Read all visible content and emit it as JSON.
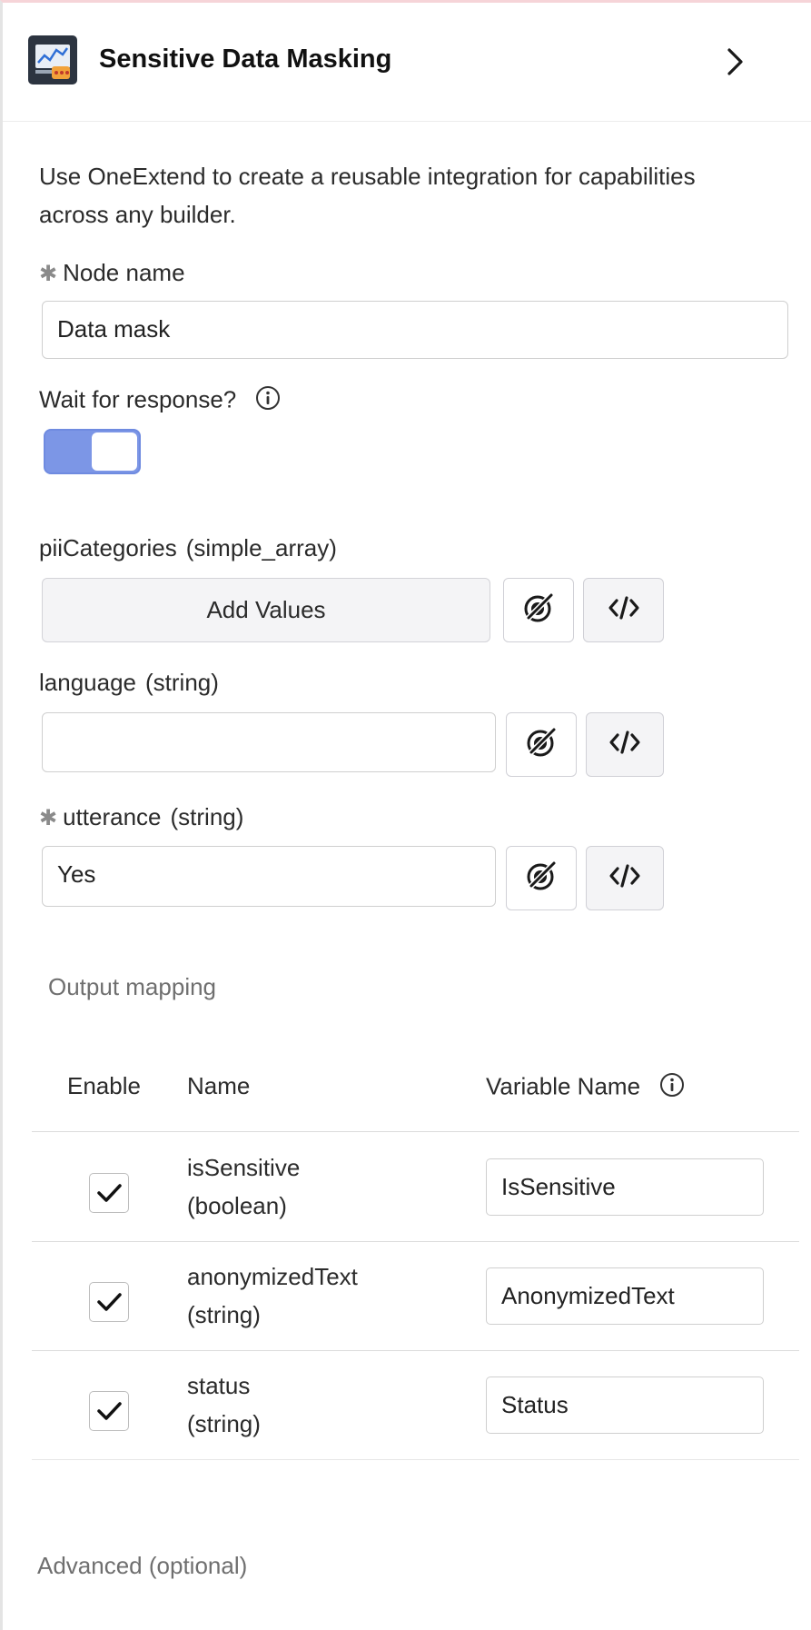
{
  "header": {
    "title": "Sensitive Data Masking",
    "app_icon": "data-masking-app-icon",
    "chevron_icon": "chevron-right-icon"
  },
  "description": "Use OneExtend to create a reusable integration for capabilities across any builder.",
  "node_name": {
    "required_mark": "✱",
    "label": "Node name",
    "value": "Data mask"
  },
  "wait_for_response": {
    "label": "Wait for response?",
    "enabled": true
  },
  "inputs": {
    "pii_categories": {
      "label": "piiCategories",
      "type": "(simple_array)",
      "button_label": "Add Values"
    },
    "language": {
      "label": "language",
      "type": "(string)",
      "value": ""
    },
    "utterance": {
      "required_mark": "✱",
      "label": "utterance",
      "type": "(string)",
      "value": "Yes"
    }
  },
  "output_mapping": {
    "title": "Output mapping",
    "columns": {
      "enable": "Enable",
      "name": "Name",
      "variable_name": "Variable Name"
    },
    "rows": [
      {
        "name": "isSensitive",
        "type": "(boolean)",
        "variable": "IsSensitive",
        "enabled": true
      },
      {
        "name": "anonymizedText",
        "type": "(string)",
        "variable": "AnonymizedText",
        "enabled": true
      },
      {
        "name": "status",
        "type": "(string)",
        "variable": "Status",
        "enabled": true
      }
    ]
  },
  "advanced": "Advanced (optional)",
  "colors": {
    "toggle_on": "#7c96e6",
    "border": "#cfcfcf",
    "muted_text": "#6f6f6f"
  }
}
